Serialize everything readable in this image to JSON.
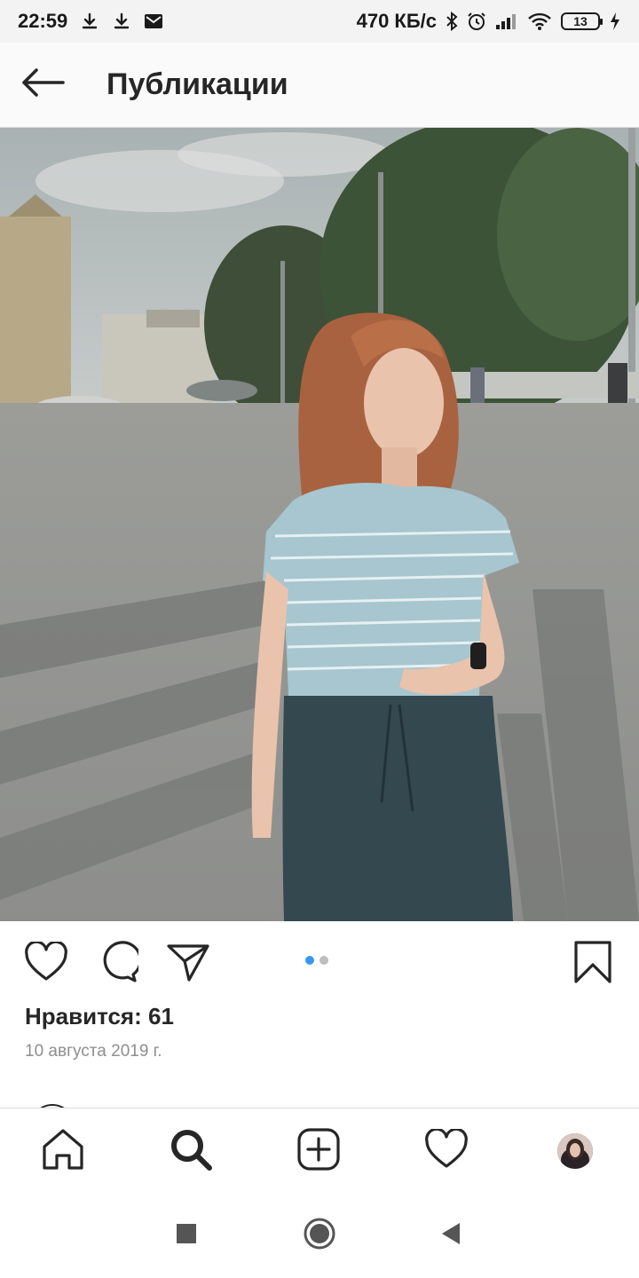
{
  "status_bar": {
    "time": "22:59",
    "speed": "470 КБ/с",
    "battery": "13",
    "icons": [
      "download-icon",
      "download-icon",
      "gmail-icon",
      "bluetooth-icon",
      "alarm-icon",
      "signal-icon",
      "wifi-icon",
      "battery-icon",
      "charging-icon"
    ]
  },
  "header": {
    "title": "Публикации",
    "back_icon": "back-arrow-icon"
  },
  "post": {
    "photo": "woman-on-street-photo",
    "carousel": {
      "count": 2,
      "active": 1
    },
    "likes": "Нравится: 61",
    "date": "10 августа 2019 г.",
    "action_icons": [
      "heart-icon",
      "comment-icon",
      "share-icon",
      "bookmark-icon"
    ]
  },
  "bottom_nav": {
    "items": [
      "home-icon",
      "search-icon",
      "add-post-icon",
      "activity-heart-icon",
      "profile-avatar"
    ]
  },
  "system_nav": {
    "items": [
      "recents-square-icon",
      "home-circle-icon",
      "back-triangle-icon"
    ]
  },
  "colors": {
    "accent_blue": "#3897f0",
    "text_primary": "#262626",
    "text_secondary": "#8e8e8e",
    "divider": "#dbdbdb"
  }
}
